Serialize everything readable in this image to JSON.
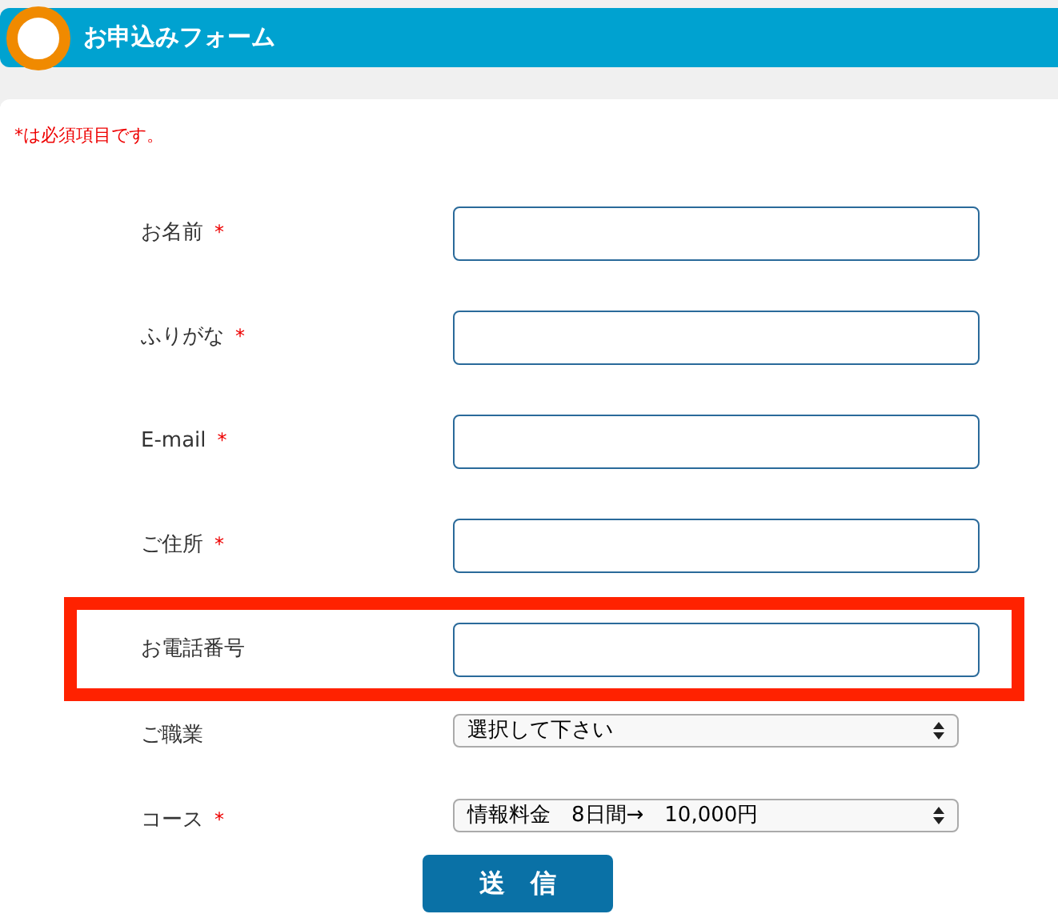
{
  "header": {
    "title": "お申込みフォーム"
  },
  "note": "*は必須項目です。",
  "fields": [
    {
      "label": "お名前",
      "mark": "*",
      "kind": "input",
      "highlighted": false
    },
    {
      "label": "ふりがな",
      "mark": "*",
      "kind": "input",
      "highlighted": false
    },
    {
      "label": "E-mail",
      "mark": "*",
      "kind": "input",
      "highlighted": false
    },
    {
      "label": "ご住所",
      "mark": "*",
      "kind": "input",
      "highlighted": false
    },
    {
      "label": "お電話番号",
      "kind": "input",
      "highlighted": true
    },
    {
      "label": "ご職業",
      "kind": "select",
      "value": "選択して下さい",
      "highlighted": false
    },
    {
      "label": "コース",
      "mark": "*",
      "kind": "select",
      "value": "情報料金　8日間→　10,000円",
      "highlighted": false
    }
  ],
  "submit": "送　信"
}
